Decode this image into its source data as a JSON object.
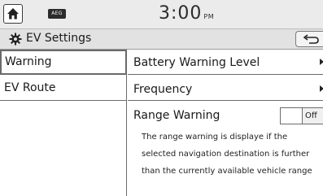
{
  "status_bar": {
    "badge": "AEG",
    "time": "3:00",
    "ampm": "PM"
  },
  "title_bar": {
    "title": "EV Settings"
  },
  "left_menu": {
    "items": [
      {
        "label": "Warning",
        "selected": true
      },
      {
        "label": "EV Route",
        "selected": false
      }
    ]
  },
  "right_panel": {
    "rows": [
      {
        "label": "Battery Warning Level"
      },
      {
        "label": "Frequency"
      }
    ],
    "range_warning": {
      "label": "Range Warning",
      "toggle_value": "Off",
      "description_lines": [
        "The range warning is displaye if the",
        "selected navigation destination is further",
        "than the currently available vehicle range"
      ]
    }
  },
  "icons": {
    "home": "home-icon",
    "settings": "gear-icon",
    "back": "back-icon",
    "arrow": "chevron-right-icon"
  }
}
